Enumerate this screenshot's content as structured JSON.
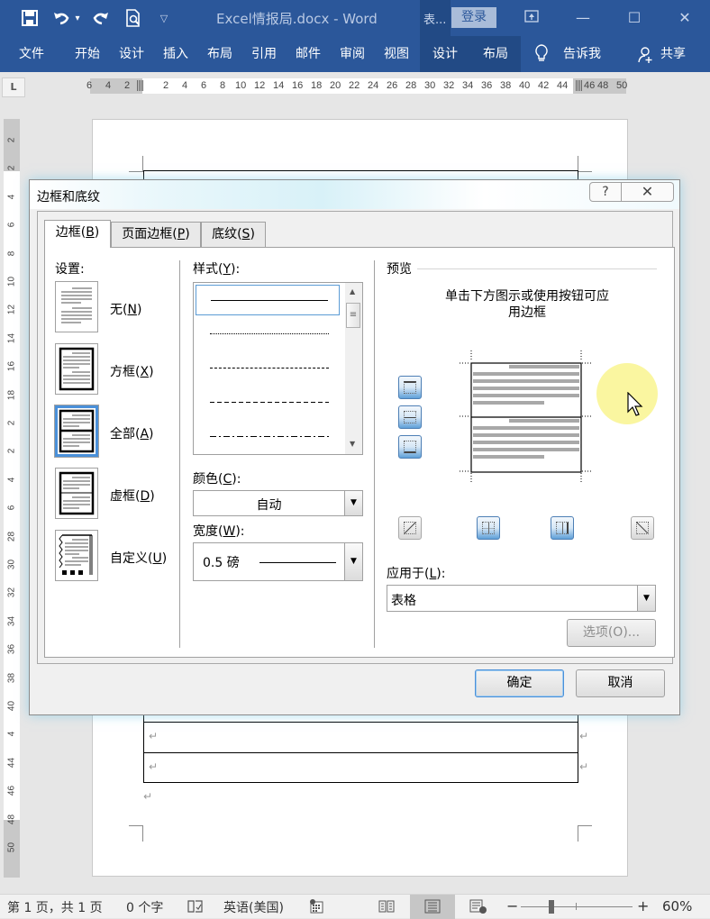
{
  "titlebar": {
    "qat": {
      "save_icon": "save-icon",
      "undo_icon": "undo-icon",
      "undo_dropdown": "▾",
      "redo_icon": "redo-icon",
      "print_preview_icon": "print-preview-icon",
      "customize_icon": "customize-qat-icon"
    },
    "title": "Excel情报局.docx  -  Word",
    "context_tab": "表...",
    "login": "登录",
    "restore_ribbon_icon": "ribbon-display-icon",
    "minimize": "—",
    "maximize": "☐",
    "close": "✕"
  },
  "ribbon": {
    "tabs": [
      {
        "label": "文件"
      },
      {
        "label": "开始"
      },
      {
        "label": "设计"
      },
      {
        "label": "插入"
      },
      {
        "label": "布局"
      },
      {
        "label": "引用"
      },
      {
        "label": "邮件"
      },
      {
        "label": "审阅"
      },
      {
        "label": "视图"
      }
    ],
    "context_tabs": [
      {
        "label": "设计"
      },
      {
        "label": "布局"
      }
    ],
    "tell_me": "告诉我",
    "share": "共享"
  },
  "ruler": {
    "corner": "L",
    "h_left": [
      "6",
      "4",
      "2"
    ],
    "h_main": [
      "2",
      "4",
      "6",
      "8",
      "10",
      "12",
      "14",
      "16",
      "18",
      "20",
      "22",
      "24",
      "26",
      "28",
      "30",
      "32",
      "34",
      "36",
      "38",
      "40",
      "42",
      "44"
    ],
    "h_right": [
      "46",
      "48",
      "50"
    ],
    "v_labels": [
      "2",
      "2",
      "4",
      "6",
      "8",
      "10",
      "12",
      "14",
      "16",
      "18",
      "2",
      "2",
      "4",
      "6",
      "28",
      "30",
      "32",
      "34",
      "36",
      "38",
      "40",
      "4",
      "44",
      "46",
      "48",
      "50"
    ]
  },
  "document": {
    "paragraph_mark": "↵"
  },
  "dialog": {
    "title": "边框和底纹",
    "help": "?",
    "close": "✕",
    "tabs": [
      {
        "label": "边框(",
        "key": "B",
        "end": ")",
        "active": true
      },
      {
        "label": "页面边框(",
        "key": "P",
        "end": ")",
        "active": false
      },
      {
        "label": "底纹(",
        "key": "S",
        "end": ")",
        "active": false
      }
    ],
    "settings_label": "设置:",
    "settings": [
      {
        "label": "无(",
        "key": "N",
        "end": ")",
        "selected": false
      },
      {
        "label": "方框(",
        "key": "X",
        "end": ")",
        "selected": false
      },
      {
        "label": "全部(",
        "key": "A",
        "end": ")",
        "selected": true
      },
      {
        "label": "虚框(",
        "key": "D",
        "end": ")",
        "selected": false
      },
      {
        "label": "自定义(",
        "key": "U",
        "end": ")",
        "selected": false
      }
    ],
    "style_label": "样式(",
    "style_key": "Y",
    "style_end": "):",
    "styles": [
      "solid",
      "dotted",
      "dashed-small",
      "dashed",
      "dash-dot"
    ],
    "selected_style": "solid",
    "color_label": "颜色(",
    "color_key": "C",
    "color_end": "):",
    "color_value": "自动",
    "width_label": "宽度(",
    "width_key": "W",
    "width_end": "):",
    "width_value": "0.5 磅",
    "preview_label": "预览",
    "preview_hint_1": "单击下方图示或使用按钮可应",
    "preview_hint_2": "用边框",
    "apply_label": "应用于(",
    "apply_key": "L",
    "apply_end": "):",
    "apply_value": "表格",
    "options_button": "选项(O)...",
    "ok_button": "确定",
    "cancel_button": "取消"
  },
  "statusbar": {
    "page": "第 1 页，共 1 页",
    "words": "0 个字",
    "proofing_icon": "proofing-icon",
    "language": "英语(美国)",
    "macro_icon": "macro-icon",
    "zoom_minus": "−",
    "zoom_plus": "+",
    "zoom_level": "60%",
    "zoom_percent": 60
  }
}
